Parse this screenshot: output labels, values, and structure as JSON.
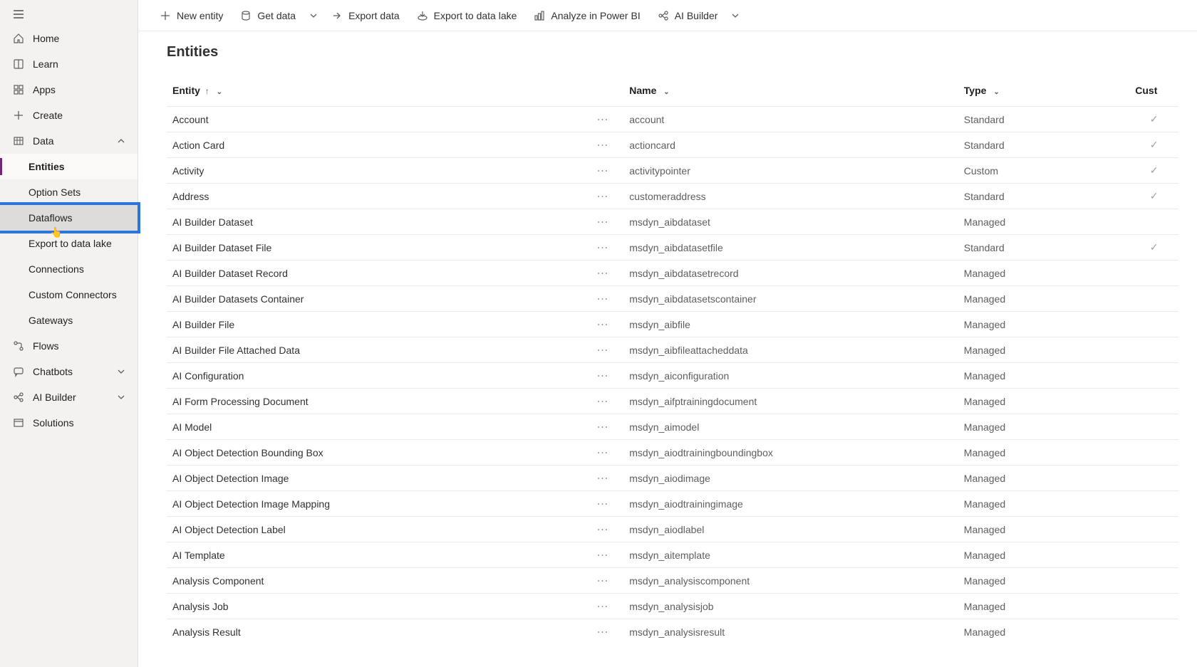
{
  "commands": {
    "new_entity": "New entity",
    "get_data": "Get data",
    "export_data": "Export data",
    "export_lake": "Export to data lake",
    "analyze_pbi": "Analyze in Power BI",
    "ai_builder": "AI Builder"
  },
  "nav": {
    "home": "Home",
    "learn": "Learn",
    "apps": "Apps",
    "create": "Create",
    "data": "Data",
    "data_children": {
      "entities": "Entities",
      "option_sets": "Option Sets",
      "dataflows": "Dataflows",
      "export_lake": "Export to data lake",
      "connections": "Connections",
      "custom_connectors": "Custom Connectors",
      "gateways": "Gateways"
    },
    "flows": "Flows",
    "chatbots": "Chatbots",
    "ai_builder": "AI Builder",
    "solutions": "Solutions"
  },
  "page": {
    "title": "Entities"
  },
  "table": {
    "headers": {
      "entity": "Entity",
      "name": "Name",
      "type": "Type",
      "cust": "Cust"
    },
    "rows": [
      {
        "entity": "Account",
        "name": "account",
        "type": "Standard",
        "cust": true
      },
      {
        "entity": "Action Card",
        "name": "actioncard",
        "type": "Standard",
        "cust": true
      },
      {
        "entity": "Activity",
        "name": "activitypointer",
        "type": "Custom",
        "cust": true
      },
      {
        "entity": "Address",
        "name": "customeraddress",
        "type": "Standard",
        "cust": true
      },
      {
        "entity": "AI Builder Dataset",
        "name": "msdyn_aibdataset",
        "type": "Managed",
        "cust": false
      },
      {
        "entity": "AI Builder Dataset File",
        "name": "msdyn_aibdatasetfile",
        "type": "Standard",
        "cust": true
      },
      {
        "entity": "AI Builder Dataset Record",
        "name": "msdyn_aibdatasetrecord",
        "type": "Managed",
        "cust": false
      },
      {
        "entity": "AI Builder Datasets Container",
        "name": "msdyn_aibdatasetscontainer",
        "type": "Managed",
        "cust": false
      },
      {
        "entity": "AI Builder File",
        "name": "msdyn_aibfile",
        "type": "Managed",
        "cust": false
      },
      {
        "entity": "AI Builder File Attached Data",
        "name": "msdyn_aibfileattacheddata",
        "type": "Managed",
        "cust": false
      },
      {
        "entity": "AI Configuration",
        "name": "msdyn_aiconfiguration",
        "type": "Managed",
        "cust": false
      },
      {
        "entity": "AI Form Processing Document",
        "name": "msdyn_aifptrainingdocument",
        "type": "Managed",
        "cust": false
      },
      {
        "entity": "AI Model",
        "name": "msdyn_aimodel",
        "type": "Managed",
        "cust": false
      },
      {
        "entity": "AI Object Detection Bounding Box",
        "name": "msdyn_aiodtrainingboundingbox",
        "type": "Managed",
        "cust": false
      },
      {
        "entity": "AI Object Detection Image",
        "name": "msdyn_aiodimage",
        "type": "Managed",
        "cust": false
      },
      {
        "entity": "AI Object Detection Image Mapping",
        "name": "msdyn_aiodtrainingimage",
        "type": "Managed",
        "cust": false
      },
      {
        "entity": "AI Object Detection Label",
        "name": "msdyn_aiodlabel",
        "type": "Managed",
        "cust": false
      },
      {
        "entity": "AI Template",
        "name": "msdyn_aitemplate",
        "type": "Managed",
        "cust": false
      },
      {
        "entity": "Analysis Component",
        "name": "msdyn_analysiscomponent",
        "type": "Managed",
        "cust": false
      },
      {
        "entity": "Analysis Job",
        "name": "msdyn_analysisjob",
        "type": "Managed",
        "cust": false
      },
      {
        "entity": "Analysis Result",
        "name": "msdyn_analysisresult",
        "type": "Managed",
        "cust": false
      }
    ]
  }
}
